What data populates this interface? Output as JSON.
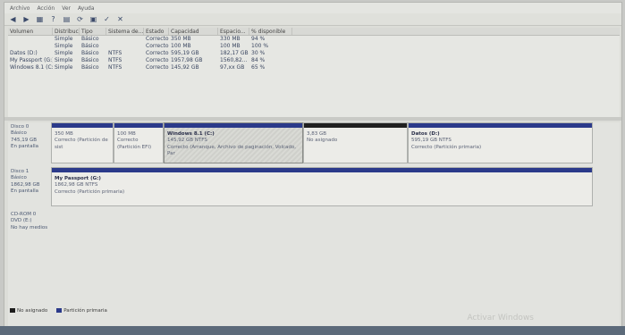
{
  "menubar": [
    "Archivo",
    "Acción",
    "Ver",
    "Ayuda"
  ],
  "toolbar_icons": [
    "back-icon",
    "forward-icon",
    "list-icon",
    "help-icon",
    "properties-icon",
    "refresh-icon",
    "disk-icon",
    "check-icon",
    "delete-icon"
  ],
  "volume_table": {
    "columns": [
      "Volumen",
      "Distribución",
      "Tipo",
      "Sistema de...",
      "Estado",
      "Capacidad",
      "Espacio...",
      "% disponible"
    ],
    "rows": [
      [
        "",
        "Simple",
        "Básico",
        "",
        "Correcto (...",
        "350 MB",
        "330 MB",
        "94 %"
      ],
      [
        "",
        "Simple",
        "Básico",
        "",
        "Correcto (...",
        "100 MB",
        "100 MB",
        "100 %"
      ],
      [
        "Datos (D:)",
        "Simple",
        "Básico",
        "NTFS",
        "Correcto (...",
        "595,19 GB",
        "182,17 GB",
        "30 %"
      ],
      [
        "My Passport (G:)",
        "Simple",
        "Básico",
        "NTFS",
        "Correcto (...",
        "1957,98 GB",
        "1560,82...",
        "84 %"
      ],
      [
        "Windows 8.1 (C:)",
        "Simple",
        "Básico",
        "NTFS",
        "Correcto (...",
        "145,92 GB",
        "97,xx GB",
        "65 %"
      ]
    ]
  },
  "disks": [
    {
      "label": [
        "Disco 0",
        "Básico",
        "745,19 GB",
        "En pantalla"
      ],
      "partitions": [
        {
          "title": "",
          "size": "350 MB",
          "status": "Correcto (Partición de sist",
          "kind": "primary"
        },
        {
          "title": "",
          "size": "100 MB",
          "status": "Correcto (Partición EFI)",
          "kind": "primary"
        },
        {
          "title": "Windows 8.1 (C:)",
          "size": "145,92 GB NTFS",
          "status": "Correcto (Arranque, Archivo de paginación, Volcado, Par",
          "kind": "selected"
        },
        {
          "title": "",
          "size": "3,83 GB",
          "status": "No asignado",
          "kind": "unalloc"
        },
        {
          "title": "Datos (D:)",
          "size": "595,19 GB NTFS",
          "status": "Correcto (Partición primaria)",
          "kind": "primary"
        }
      ]
    },
    {
      "label": [
        "Disco 1",
        "Básico",
        "1862,98 GB",
        "En pantalla"
      ],
      "partitions": [
        {
          "title": "My Passport (G:)",
          "size": "1862,98 GB NTFS",
          "status": "Correcto (Partición primaria)",
          "kind": "primary"
        }
      ]
    },
    {
      "label": [
        "CD-ROM 0",
        "DVD (E:)",
        "",
        "No hay medios"
      ],
      "partitions": []
    }
  ],
  "legend": [
    {
      "label": "No asignado",
      "color": "#1c1c1c"
    },
    {
      "label": "Partición primaria",
      "color": "#2b3a8a"
    }
  ],
  "watermark": "Activar Windows"
}
